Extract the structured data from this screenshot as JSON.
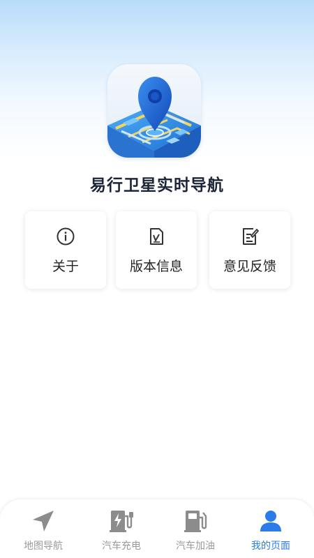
{
  "app": {
    "name": "易行卫星实时导航",
    "icon": "map-location-pin-icon"
  },
  "menu": {
    "items": [
      {
        "label": "关于",
        "icon": "info-circle-icon"
      },
      {
        "label": "版本信息",
        "icon": "document-check-icon"
      },
      {
        "label": "意见反馈",
        "icon": "edit-feedback-icon"
      }
    ]
  },
  "tabbar": {
    "active_color": "#2b7ce8",
    "inactive_color": "#9a9a9a",
    "tabs": [
      {
        "label": "地图导航",
        "icon": "navigation-arrow-icon",
        "active": false
      },
      {
        "label": "汽车充电",
        "icon": "charging-station-icon",
        "active": false
      },
      {
        "label": "汽车加油",
        "icon": "fuel-pump-icon",
        "active": false
      },
      {
        "label": "我的页面",
        "icon": "user-icon",
        "active": true
      }
    ]
  }
}
